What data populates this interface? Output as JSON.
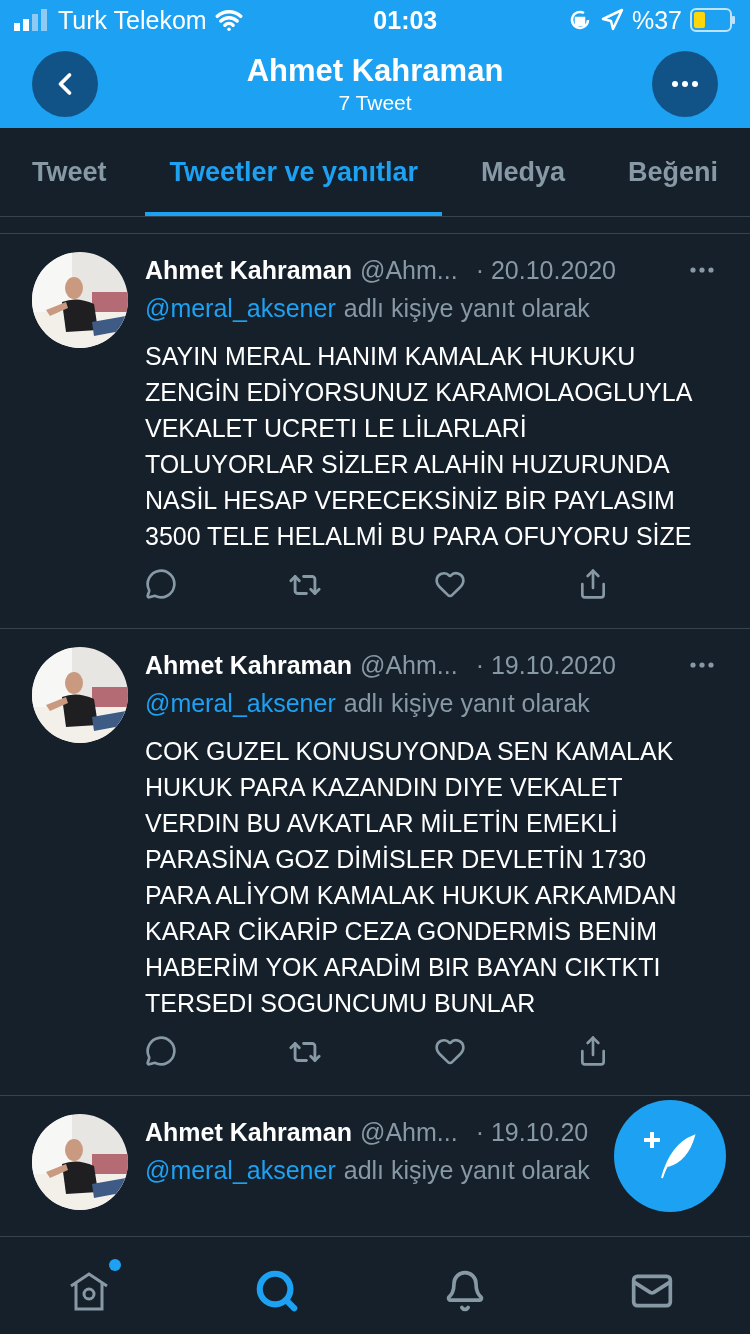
{
  "status_bar": {
    "carrier": "Turk Telekom",
    "time": "01:03",
    "battery": "%37"
  },
  "header": {
    "title": "Ahmet Kahraman",
    "subtitle": "7 Tweet"
  },
  "tabs": [
    {
      "label": "Tweet",
      "selected": false
    },
    {
      "label": "Tweetler ve yanıtlar",
      "selected": true
    },
    {
      "label": "Medya",
      "selected": false
    },
    {
      "label": "Beğeni",
      "selected": false
    }
  ],
  "tweets": [
    {
      "name": "Ahmet Kahraman",
      "handle": "@Ahm...",
      "date": "· 20.10.2020",
      "reply_to": "@meral_aksener",
      "reply_text": "adlı kişiye yanıt olarak",
      "text": "SAYIN MERAL HANIM KAMALAK HUKUKU ZENGİN EDİYORSUNUZ KARAMOLAOGLUYLA VEKALET UCRETI LE LİLARLARİ TOLUYORLAR SİZLER ALAHİN HUZURUNDA NASİL HESAP VERECEKSİNİZ BİR PAYLASIM 3500 TELE HELALMİ BU PARA OFUYORU SİZE"
    },
    {
      "name": "Ahmet Kahraman",
      "handle": "@Ahm...",
      "date": "· 19.10.2020",
      "reply_to": "@meral_aksener",
      "reply_text": "adlı kişiye yanıt olarak",
      "text": "COK GUZEL KONUSUYONDA SEN KAMALAK HUKUK PARA KAZANDIN DIYE VEKALET VERDIN BU AVKATLAR MİLETİN EMEKLİ PARASİNA GOZ DİMİSLER DEVLETİN 1730 PARA ALİYOM KAMALAK HUKUK ARKAMDAN KARAR CİKARİP CEZA GONDERMİS BENİM  HABERİM YOK ARADİM BIR BAYAN CIKTKTI TERSEDI SOGUNCUMU BUNLAR"
    },
    {
      "name": "Ahmet Kahraman",
      "handle": "@Ahm...",
      "date": "· 19.10.20",
      "reply_to": "@meral_aksener",
      "reply_text": "adlı kişiye yanıt olarak"
    }
  ],
  "bottom_nav": [
    {
      "kind": "home",
      "selected": false
    },
    {
      "kind": "search",
      "selected": true
    },
    {
      "kind": "bell",
      "selected": false
    },
    {
      "kind": "mail",
      "selected": false
    }
  ]
}
